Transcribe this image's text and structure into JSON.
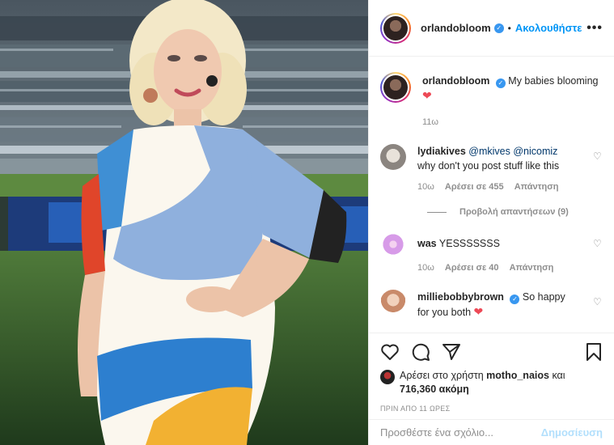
{
  "post": {
    "author": "orlandobloom",
    "follow_label": "Ακολουθήστε",
    "dot": "•",
    "more": "•••",
    "caption": {
      "user": "orlandobloom",
      "text": "My babies blooming",
      "emoji": "❤",
      "time": "11ω"
    }
  },
  "comments": [
    {
      "user": "lydiakives",
      "mention1": "@mkives",
      "mention2": "@nicomiz",
      "text": "why don't you post stuff like this",
      "time": "10ω",
      "likes": "Αρέσει σε 455",
      "reply": "Απάντηση",
      "view_replies": "Προβολή απαντήσεων (9)"
    },
    {
      "user": "was",
      "text": "YESSSSSSS",
      "time": "10ω",
      "likes": "Αρέσει σε 40",
      "reply": "Απάντηση"
    },
    {
      "user": "milliebobbybrown",
      "text": "So happy",
      "text2": "for you both",
      "emoji": "❤"
    }
  ],
  "actions": {
    "liked_by_prefix": "Αρέσει στο χρήστη",
    "liked_by_user": "motho_naios",
    "liked_by_and": "και",
    "likes_more": "716,360 ακόμη",
    "timestamp": "ΠΡΙΝ ΑΠΟ 11 ΩΡΕΣ"
  },
  "comment_box": {
    "placeholder": "Προσθέστε ένα σχόλιο...",
    "post_label": "Δημοσίευση"
  },
  "colors": {
    "accent": "#0095f6",
    "verified": "#3897f0",
    "heart": "#ed4956",
    "muted": "#8e8e8e"
  }
}
